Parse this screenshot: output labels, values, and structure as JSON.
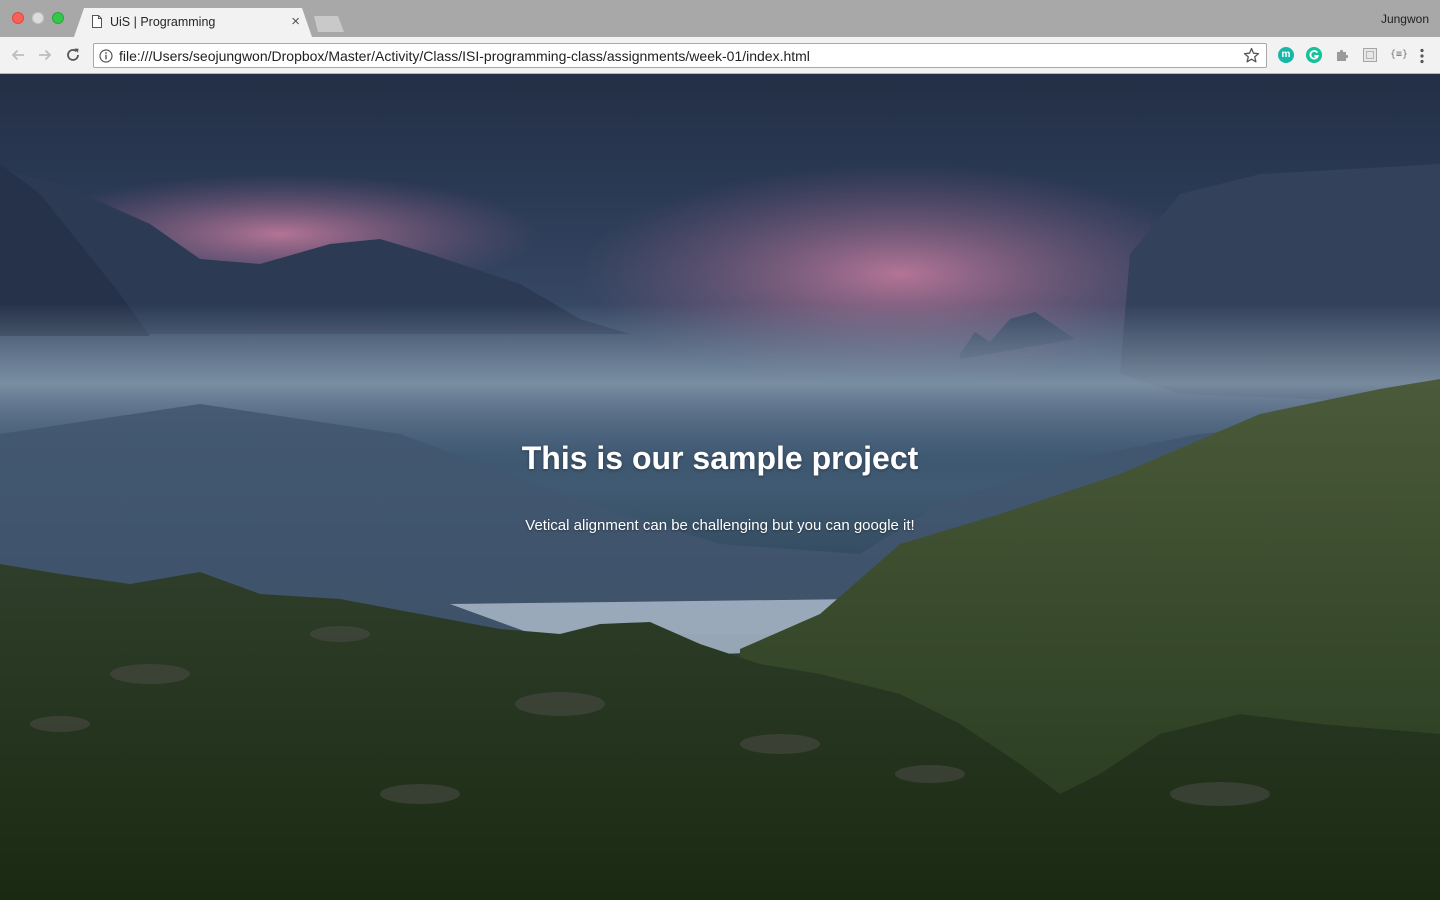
{
  "browser": {
    "tab_title": "UiS | Programming",
    "tab_close": "×",
    "profile_name": "Jungwon",
    "url": "file:///Users/seojungwon/Dropbox/Master/Activity/Class/ISI-programming-class/assignments/week-01/index.html",
    "extensions": {
      "m_label": "m",
      "json_label": "{≡}"
    }
  },
  "page": {
    "title": "This is our sample project",
    "subtitle": "Vetical alignment can be challenging but you can google it!"
  },
  "colors": {
    "sky": "#2b3a55",
    "clouds_pink": "#b06a8e",
    "mist": "#7d93a6",
    "hills_green": "#2f4a1f",
    "water": "#a9b8c9"
  }
}
